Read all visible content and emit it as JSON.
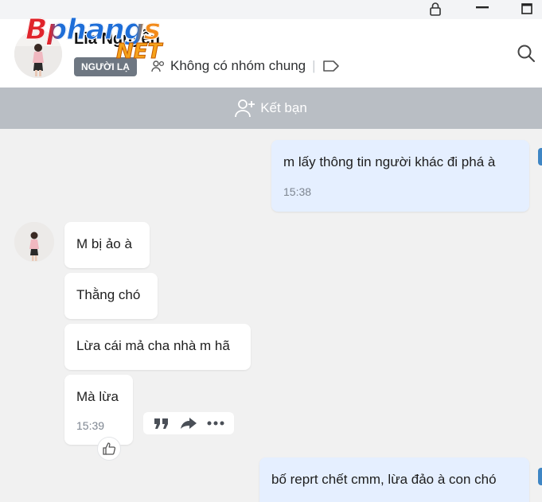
{
  "window": {
    "lock_icon": "lock-icon",
    "minimize_icon": "minimize-icon",
    "maximize_icon": "maximize-icon"
  },
  "header": {
    "contact_name": "Lia Nguyễn",
    "stranger_badge": "NGƯỜI LẠ",
    "group_info": "Không có nhóm chung",
    "search_icon": "search-icon",
    "tag_icon": "tag-icon"
  },
  "watermark": {
    "top": "Bphangs",
    "bottom": "NET"
  },
  "friend_bar": {
    "label": "Kết bạn",
    "icon": "add-user-icon"
  },
  "messages": [
    {
      "direction": "out",
      "text": "m lấy thông tin người khác đi phá à",
      "time": "15:38"
    },
    {
      "direction": "in",
      "text": "M bị ảo à"
    },
    {
      "direction": "in",
      "text": "Thằng chó"
    },
    {
      "direction": "in",
      "text": "Lừa cái mả cha nhà m hã"
    },
    {
      "direction": "in",
      "text": "Mà lừa",
      "time": "15:39"
    },
    {
      "direction": "out",
      "text": "bố reprt chết cmm, lừa đảo à con chó"
    }
  ],
  "message_actions": [
    "quote-icon",
    "forward-icon",
    "more-icon"
  ],
  "reaction": {
    "icon": "thumbs-up-icon"
  },
  "colors": {
    "outgoing_bubble": "#e5efff",
    "incoming_bubble": "#ffffff",
    "friend_bar": "#b9bec4",
    "badge": "#6e7782"
  }
}
